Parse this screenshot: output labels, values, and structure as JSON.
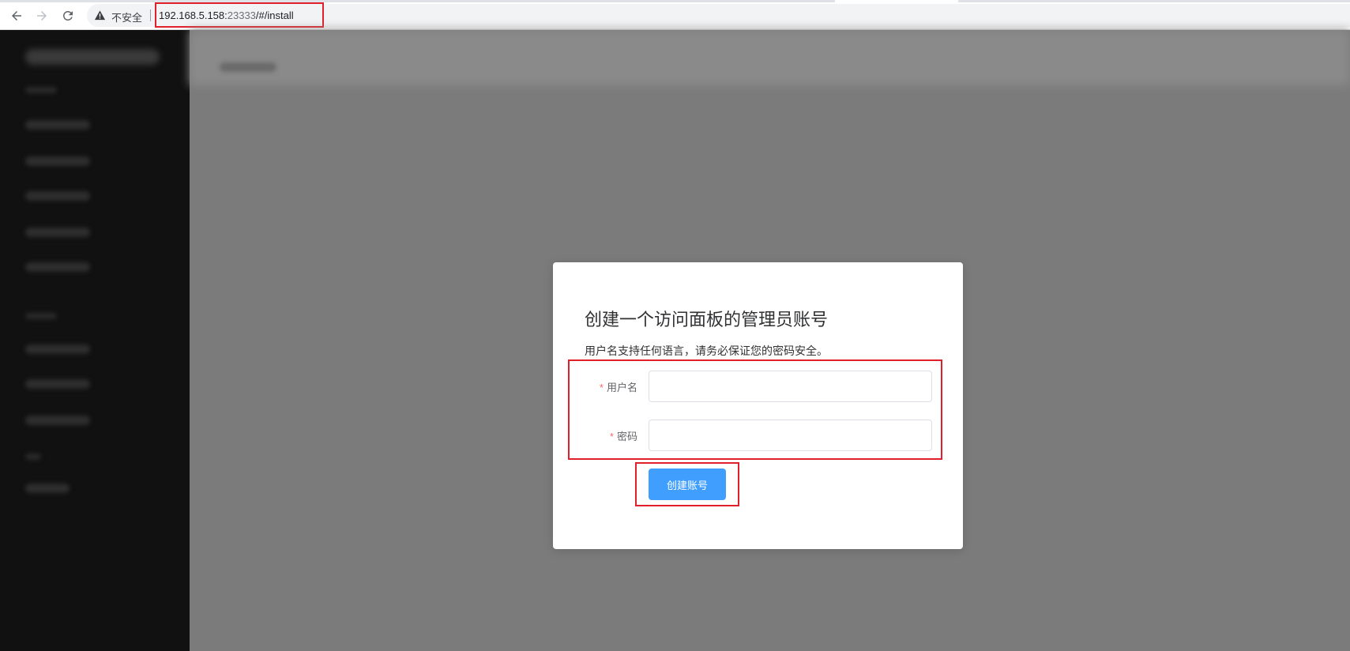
{
  "browser": {
    "security_text": "不安全",
    "url_host": "192.168.5.158:",
    "url_port": "23333",
    "url_path": "/#/install"
  },
  "dialog": {
    "title": "创建一个访问面板的管理员账号",
    "description": "用户名支持任何语言，请务必保证您的密码安全。",
    "username_label": "用户名",
    "password_label": "密码",
    "required_mark": "*",
    "username_value": "",
    "password_value": "",
    "submit_label": "创建账号"
  },
  "colors": {
    "primary": "#409eff",
    "highlight_red": "#e0202a",
    "required": "#f56c6c"
  }
}
